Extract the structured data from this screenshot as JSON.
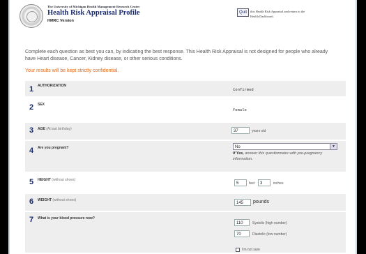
{
  "header": {
    "university": "The University of Michigan Health Management Research Center",
    "title": "Health Risk Appraisal Profile",
    "version": "HMRC Version",
    "quit_label": "Quit",
    "quit_note": "this Health Risk Appraisal and return to the Health Dashboard."
  },
  "intro": "Complete each question as best you can, by indicating the best response. This Health Risk Appraisal is not designed for people who already have Heart disease, Cancer, Kidney disease, or other serious conditions.",
  "confidential": "Your results will be kept strictly confidential.",
  "questions": {
    "q1": {
      "num": "1",
      "label": "AUTHORIZATION",
      "value": "Confirmed"
    },
    "q2": {
      "num": "2",
      "label": "SEX",
      "value": "Female"
    },
    "q3": {
      "num": "3",
      "label": "AGE",
      "sub": "(At last birthday)",
      "value": "37",
      "unit": "years old"
    },
    "q4": {
      "num": "4",
      "label": "Are you pregnant?",
      "value": "No",
      "note_bold": "If Yes,",
      "note": " answer this questionnaire with pre-pregnancy information."
    },
    "q5": {
      "num": "5",
      "label": "HEIGHT",
      "sub": "(without shoes)",
      "feet": "5",
      "feet_unit": "feet",
      "inches": "3",
      "inches_unit": "inches"
    },
    "q6": {
      "num": "6",
      "label": "WEIGHT",
      "sub": "(without shoes)",
      "value": "145",
      "unit": "pounds"
    },
    "q7": {
      "num": "7",
      "label": "What is your blood pressure now?",
      "systolic": "110",
      "systolic_label": "Systolic (high number)",
      "diastolic": "70",
      "diastolic_label": "Diastolic (low number)",
      "not_sure": "I'm not sure"
    }
  }
}
